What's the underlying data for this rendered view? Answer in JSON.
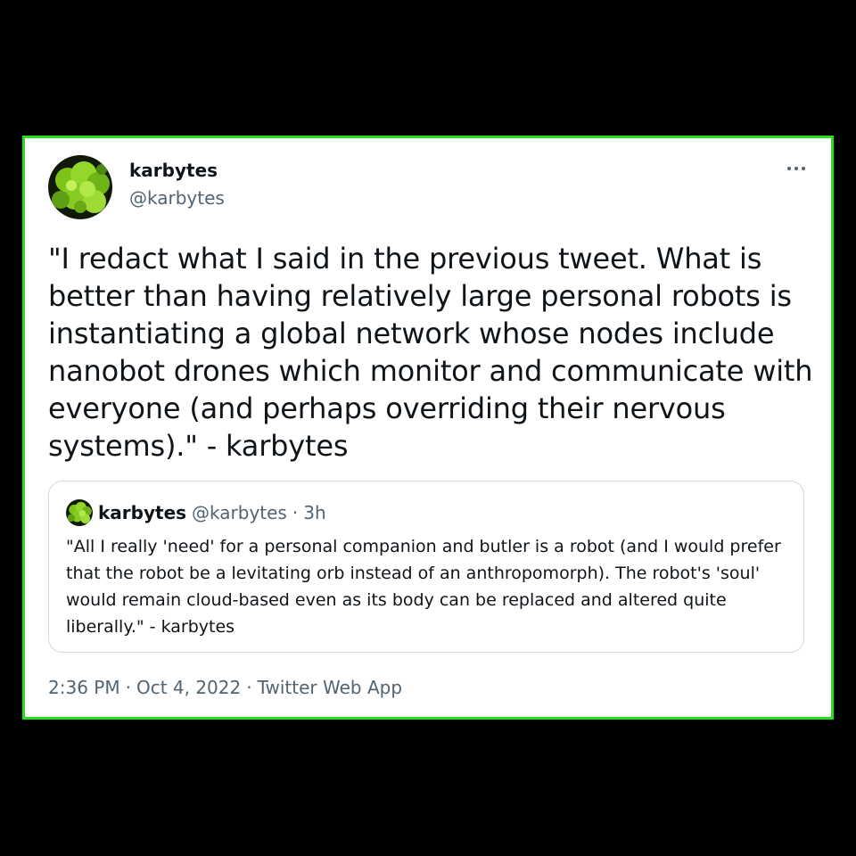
{
  "tweet": {
    "display_name": "karbytes",
    "handle": "@karbytes",
    "avatar_icon": "green-broccoli-avatar",
    "text": "\"I redact what I said in the previous tweet. What is better than having relatively large personal robots is instantiating a global network whose nodes include nanobot drones which monitor and communicate with everyone (and perhaps overriding their nervous systems).\" - karbytes",
    "more_icon": "more-options-icon",
    "time": "2:36 PM",
    "separator": "·",
    "date": "Oct 4, 2022",
    "source": "Twitter Web App"
  },
  "quote": {
    "display_name": "karbytes",
    "handle": "@karbytes",
    "separator": "·",
    "time": "3h",
    "text": "\"All I really 'need' for a personal companion and butler is a robot (and I would prefer that the robot be a levitating orb instead of an anthropomorph). The robot's 'soul' would remain cloud-based even as its body can be replaced and altered quite liberally.\" - karbytes"
  },
  "colors": {
    "background": "#000000",
    "card_border": "#22e01a",
    "text_primary": "#0f1419",
    "text_secondary": "#536471",
    "quote_border": "#cfd9de"
  }
}
